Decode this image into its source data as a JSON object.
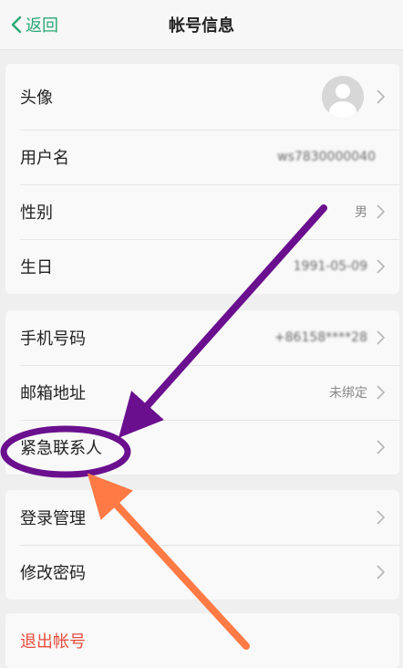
{
  "nav": {
    "back_label": "返回",
    "title": "帐号信息"
  },
  "group1": {
    "avatar_label": "头像",
    "username_label": "用户名",
    "username_value": "ws7830000040",
    "gender_label": "性别",
    "gender_value": "男",
    "birthday_label": "生日",
    "birthday_value": "1991-05-09"
  },
  "group2": {
    "phone_label": "手机号码",
    "phone_value": "+86158****28",
    "email_label": "邮箱地址",
    "email_value": "未绑定",
    "emergency_label": "紧急联系人"
  },
  "group3": {
    "login_label": "登录管理",
    "password_label": "修改密码"
  },
  "group4": {
    "logout_label": "退出帐号"
  },
  "colors": {
    "accent": "#2aa876",
    "logout": "#e74c3c",
    "annotation_purple": "#6a0f8e",
    "annotation_orange": "#ff7a45"
  }
}
